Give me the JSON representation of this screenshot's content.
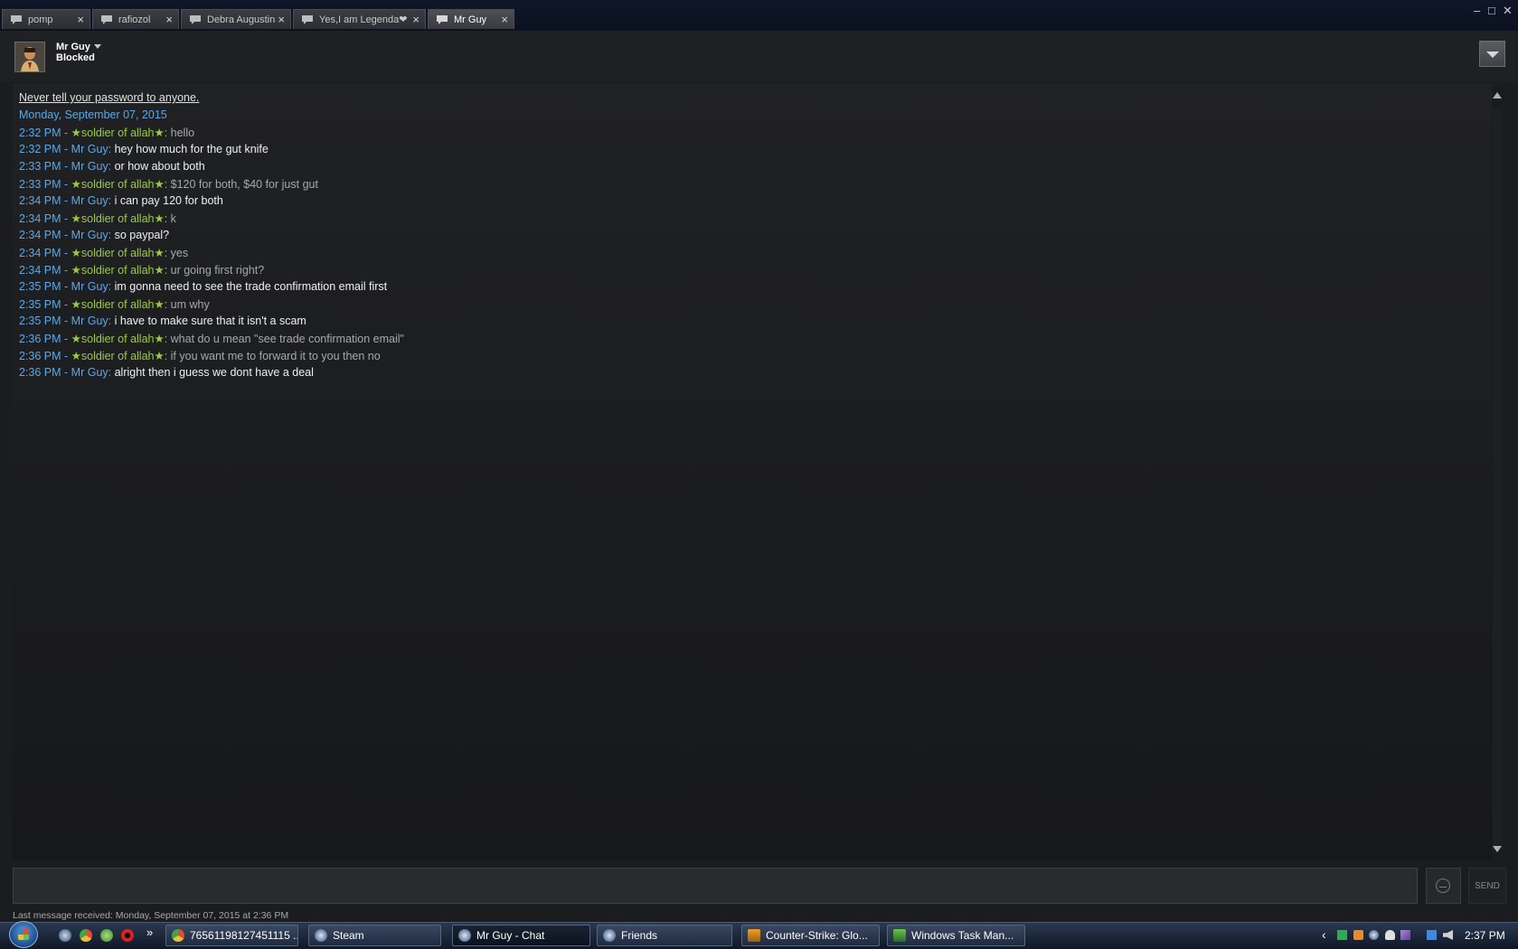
{
  "tabs": [
    {
      "label": "pomp",
      "active": false
    },
    {
      "label": "rafiozol",
      "active": false
    },
    {
      "label": "Debra Augustin",
      "active": false
    },
    {
      "label": "Yes,I am Legenda❤",
      "active": false
    },
    {
      "label": "Mr Guy",
      "active": true
    }
  ],
  "tab_close": "×",
  "window": {
    "minimize": "–",
    "maximize": "□",
    "close": "✕"
  },
  "header": {
    "name": "Mr Guy",
    "status": "Blocked"
  },
  "chat": {
    "warning": "Never tell your password to anyone.",
    "date": "Monday, September 07, 2015",
    "messages": [
      {
        "time": "2:32 PM",
        "sender": "★soldier of allah★",
        "text": "hello",
        "self": false
      },
      {
        "time": "2:32 PM",
        "sender": "Mr Guy",
        "text": "hey how much for the gut knife",
        "self": true
      },
      {
        "time": "2:33 PM",
        "sender": "Mr Guy",
        "text": "or how about both",
        "self": true
      },
      {
        "time": "2:33 PM",
        "sender": "★soldier of allah★",
        "text": "$120 for both, $40 for just gut",
        "self": false
      },
      {
        "time": "2:34 PM",
        "sender": "Mr Guy",
        "text": "i can pay 120 for both",
        "self": true
      },
      {
        "time": "2:34 PM",
        "sender": "★soldier of allah★",
        "text": "k",
        "self": false
      },
      {
        "time": "2:34 PM",
        "sender": "Mr Guy",
        "text": "so paypal?",
        "self": true
      },
      {
        "time": "2:34 PM",
        "sender": "★soldier of allah★",
        "text": "yes",
        "self": false
      },
      {
        "time": "2:34 PM",
        "sender": "★soldier of allah★",
        "text": "ur going first right?",
        "self": false
      },
      {
        "time": "2:35 PM",
        "sender": "Mr Guy",
        "text": "im gonna need to see the trade confirmation email first",
        "self": true
      },
      {
        "time": "2:35 PM",
        "sender": "★soldier of allah★",
        "text": "um why",
        "self": false
      },
      {
        "time": "2:35 PM",
        "sender": "Mr Guy",
        "text": "i have to make sure that it isn't a scam",
        "self": true
      },
      {
        "time": "2:36 PM",
        "sender": "★soldier of allah★",
        "text": "what do u mean \"see trade confirmation email\"",
        "self": false
      },
      {
        "time": "2:36 PM",
        "sender": "★soldier of allah★",
        "text": "if you want me to forward it to you then no",
        "self": false
      },
      {
        "time": "2:36 PM",
        "sender": "Mr Guy",
        "text": "alright then i guess we dont have a deal",
        "self": true
      }
    ],
    "input_value": "",
    "send_label": "SEND",
    "last_received": "Last message received: Monday, September 07, 2015 at 2:36 PM"
  },
  "taskbar": {
    "items": [
      {
        "label": "76561198127451115 ...",
        "icon": "chrome-icon",
        "active": false
      },
      {
        "label": "Steam",
        "icon": "steam-icon",
        "active": false
      },
      {
        "label": "Mr Guy - Chat",
        "icon": "steam-icon",
        "active": true
      },
      {
        "label": "Friends",
        "icon": "steam-icon",
        "active": false
      },
      {
        "label": "Counter-Strike: Glo...",
        "icon": "csgo-icon",
        "active": false
      },
      {
        "label": "Windows Task Man...",
        "icon": "task-manager-icon",
        "active": false
      }
    ],
    "more_glyph": "»",
    "tray_expand": "‹",
    "clock": "2:37 PM"
  },
  "colors": {
    "timestamp": "#5aa9e6",
    "friend_name": "#9bcc3b",
    "self_text": "#f0f0f0",
    "friend_text": "#a8a8a8",
    "background": "#1b1c1e"
  }
}
